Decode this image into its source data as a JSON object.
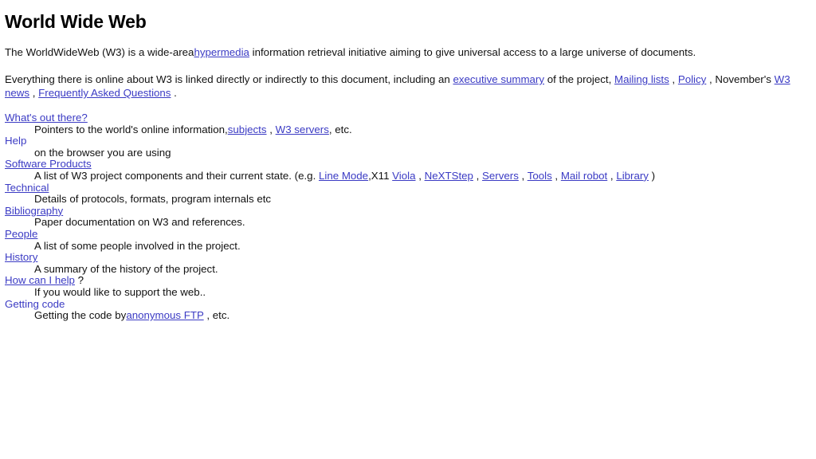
{
  "page": {
    "title": "World Wide Web",
    "link_color": "#3b3bc4",
    "text_color": "#111111",
    "background_color": "#ffffff"
  },
  "intro": {
    "p1": {
      "before": "The WorldWideWeb (W3) is a wide-area",
      "link": "hypermedia",
      "after": "information retrieval initiative aiming to give universal access to a large universe of documents."
    },
    "p2": {
      "before": "Everything there is online about W3 is linked directly or indirectly to this document, including an",
      "link_executive_summary": "executive summary",
      "mid1": "of the project,",
      "link_mailing_lists": "Mailing lists",
      "sep1": ",",
      "link_policy": "Policy",
      "sep2": ", November's",
      "link_w3_news": "W3 news",
      "sep3": ",",
      "link_faq": "Frequently Asked Questions",
      "after": "."
    }
  },
  "sections": [
    {
      "term": "What's out there?",
      "term_is_link": true,
      "desc_before": "Pointers to the world's online information,",
      "desc_links": [
        "subjects",
        "W3 servers"
      ],
      "desc_sep": ",",
      "desc_after": ", etc."
    },
    {
      "term": "Help",
      "term_is_link": true,
      "term_underlined": false,
      "desc_before": "on the browser you are using",
      "desc_links": [],
      "desc_after": ""
    },
    {
      "term": "Software Products",
      "term_is_link": true,
      "desc_before": "A list of W3 project components and their current state. (e.g.",
      "desc_links": [
        "Line Mode",
        "Viola",
        "NeXTStep",
        "Servers",
        "Tools",
        "Mail robot",
        "Library"
      ],
      "desc_x11": ",X11",
      "desc_after": ")"
    },
    {
      "term": "Technical",
      "term_is_link": true,
      "desc_before": "Details of protocols, formats, program internals etc",
      "desc_links": [],
      "desc_after": ""
    },
    {
      "term": "Bibliography",
      "term_is_link": true,
      "desc_before": "Paper documentation on W3 and references.",
      "desc_links": [],
      "desc_after": ""
    },
    {
      "term": "People",
      "term_is_link": true,
      "desc_before": "A list of some people involved in the project.",
      "desc_links": [],
      "desc_after": ""
    },
    {
      "term": "History",
      "term_is_link": true,
      "desc_before": "A summary of the history of the project.",
      "desc_links": [],
      "desc_after": ""
    },
    {
      "term": "How can I help",
      "term_is_link": true,
      "term_suffix": "?",
      "desc_before": "If you would like to support the web..",
      "desc_links": [],
      "desc_after": ""
    },
    {
      "term": "Getting code",
      "term_is_link": true,
      "term_underlined": false,
      "desc_before": "Getting the code by",
      "desc_links": [
        "anonymous FTP"
      ],
      "desc_after": ", etc."
    }
  ]
}
